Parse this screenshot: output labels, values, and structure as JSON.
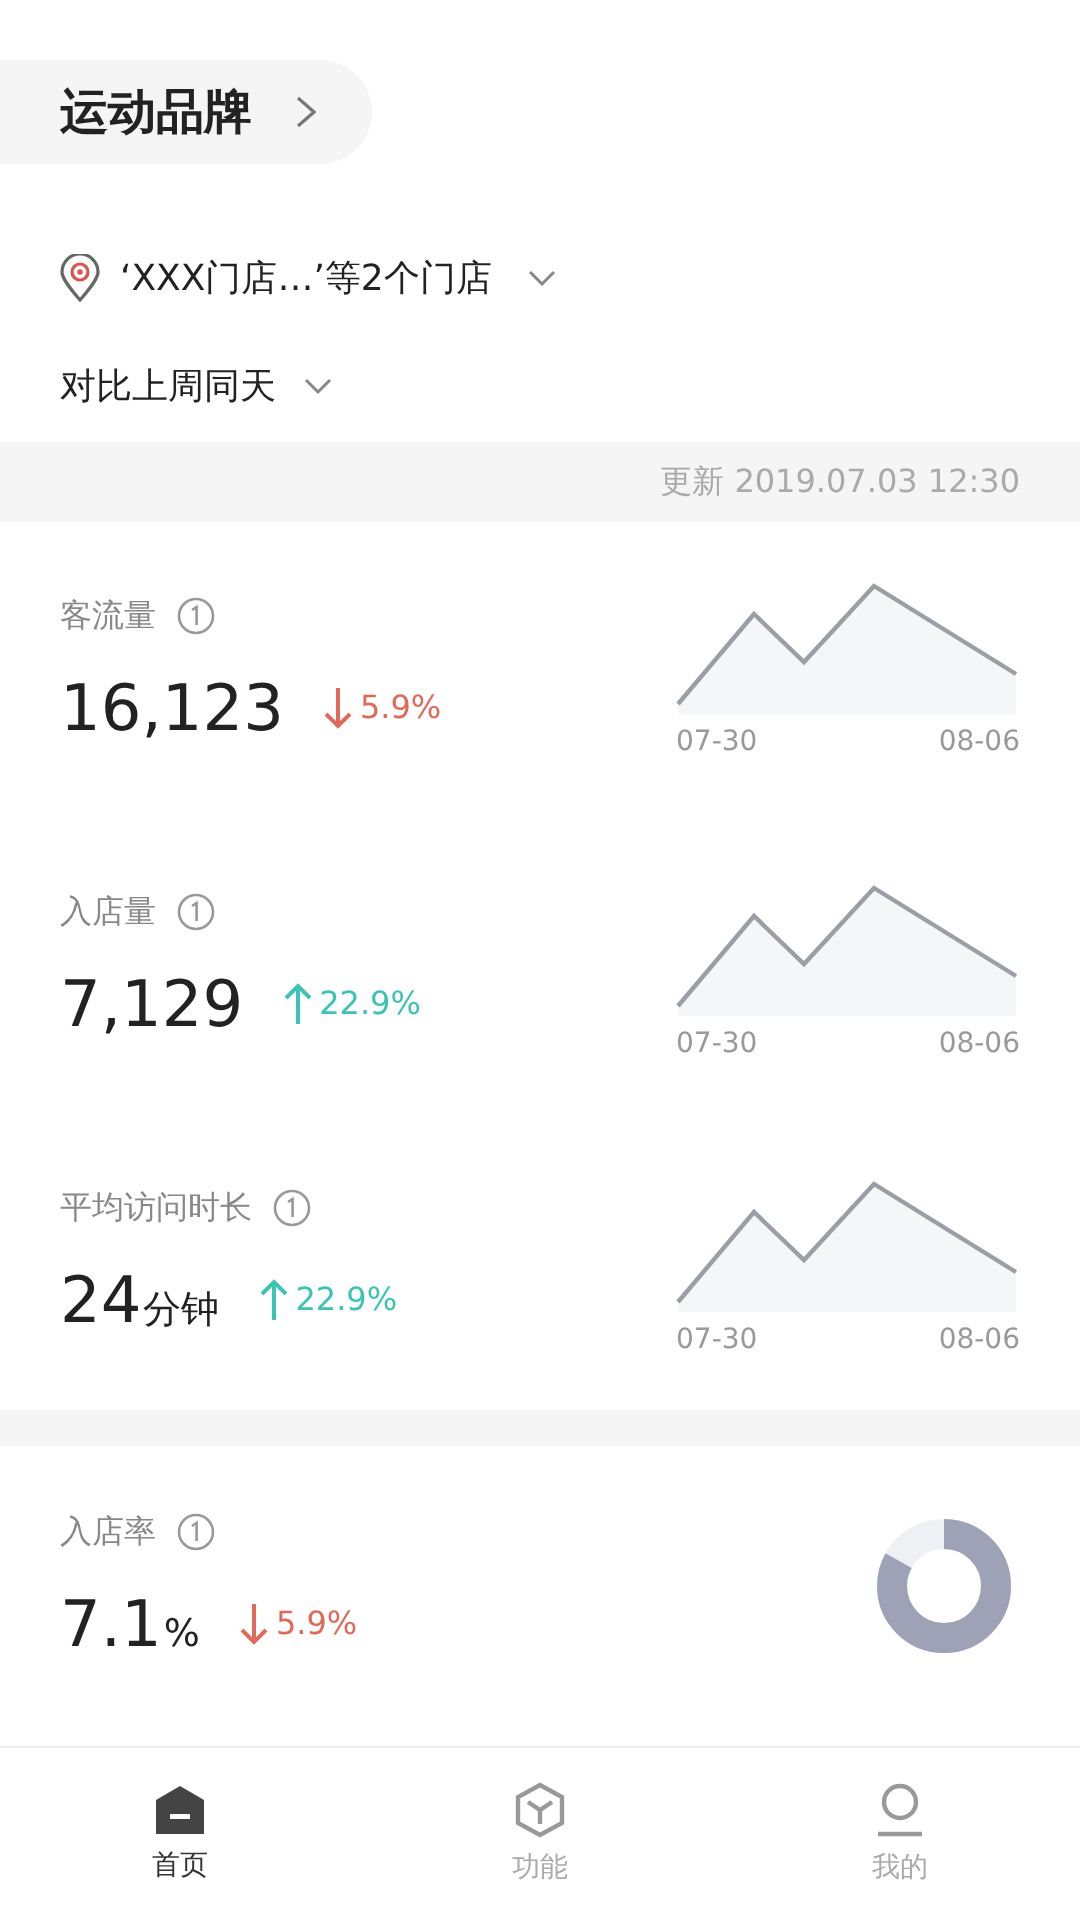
{
  "header": {
    "brand": "运动品牌"
  },
  "filters": {
    "stores": "‘XXX门店…’等2个门店",
    "compare": "对比上周同天"
  },
  "update_time": "更新 2019.07.03 12:30",
  "metrics": [
    {
      "kind": "sparkline",
      "label": "客流量",
      "value": "16,123",
      "increase": false,
      "change": "5.9%",
      "x_start": "07-30",
      "x_end": "08-06"
    },
    {
      "kind": "sparkline",
      "label": "入店量",
      "value": "7,129",
      "increase": true,
      "change": "22.9%",
      "x_start": "07-30",
      "x_end": "08-06"
    },
    {
      "kind": "sparkline",
      "label": "平均访问时长",
      "value": "24",
      "unit": "分钟",
      "increase": true,
      "change": "22.9%",
      "x_start": "07-30",
      "x_end": "08-06"
    },
    {
      "kind": "donut",
      "label": "入店率",
      "value": "7.1",
      "unit": "%",
      "increase": false,
      "change": "5.9%",
      "level": 0.83
    }
  ],
  "tabs": [
    {
      "kind": "home",
      "label": "首页",
      "selected": true
    },
    {
      "kind": "features",
      "label": "功能",
      "selected": false
    },
    {
      "kind": "profile",
      "label": "我的",
      "selected": false
    }
  ]
}
